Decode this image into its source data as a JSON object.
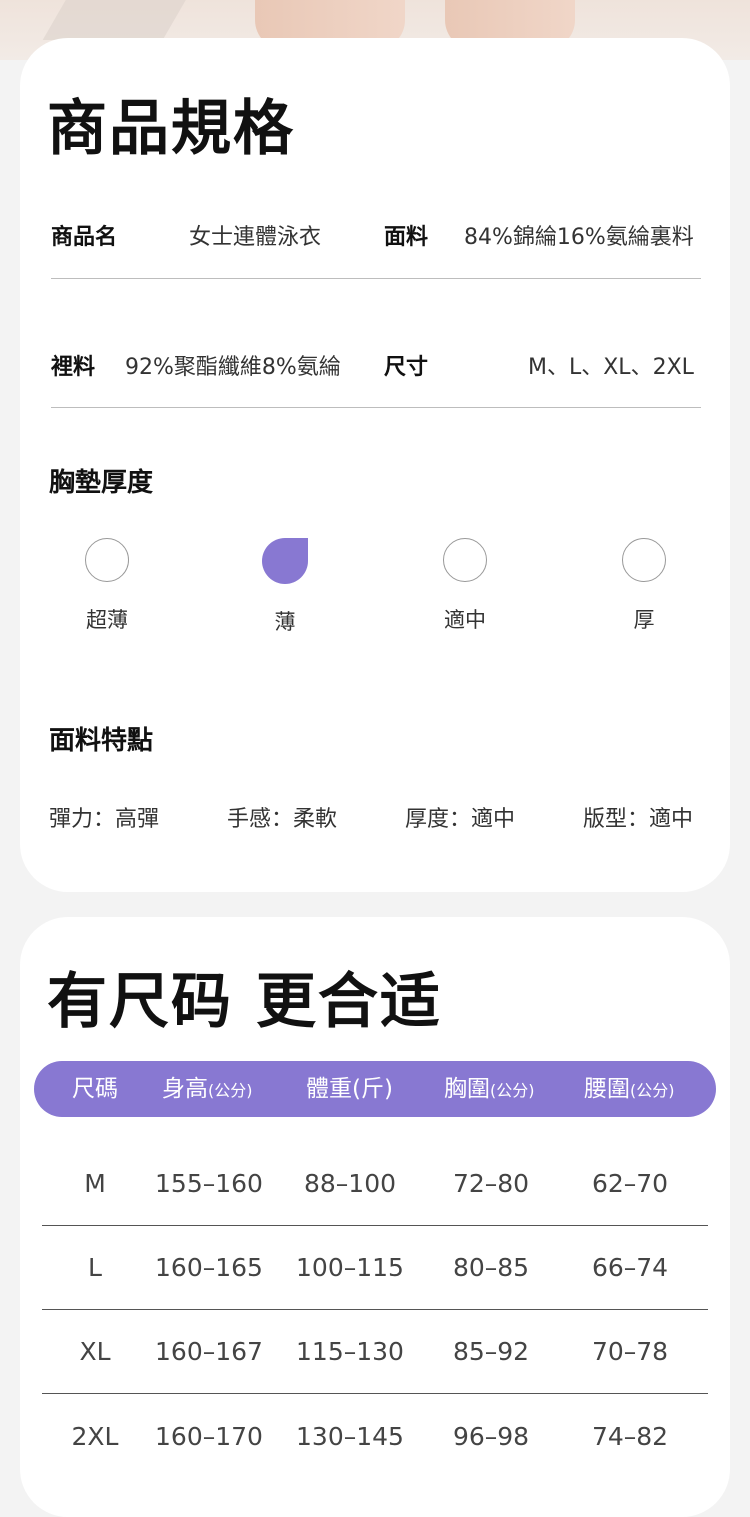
{
  "spec": {
    "title": "商品規格",
    "row1": {
      "name_label": "商品名",
      "name_value": "女士連體泳衣",
      "fabric_label": "面料",
      "fabric_value": "84%錦綸16%氨綸裏料"
    },
    "row2": {
      "lining_label": "裡料",
      "lining_value": "92%聚酯纖維8%氨綸",
      "size_label": "尺寸",
      "size_value": "M、L、XL、2XL"
    },
    "padding": {
      "title": "胸墊厚度",
      "options": [
        {
          "label": "超薄",
          "selected": false
        },
        {
          "label": "薄",
          "selected": true
        },
        {
          "label": "適中",
          "selected": false
        },
        {
          "label": "厚",
          "selected": false
        }
      ],
      "accent_color": "#8878d2"
    },
    "features": {
      "title": "面料特點",
      "items": [
        "彈力：高彈",
        "手感：柔軟",
        "厚度：適中",
        "版型：適中"
      ]
    }
  },
  "size_chart": {
    "title": "有尺码 更合适",
    "header": {
      "size": "尺碼",
      "height": "身高",
      "height_unit": "(公分)",
      "weight": "體重(斤)",
      "bust": "胸圍",
      "bust_unit": "(公分)",
      "waist": "腰圍",
      "waist_unit": "(公分)"
    },
    "rows": [
      [
        "M",
        "155–160",
        "88–100",
        "72–80",
        "62–70"
      ],
      [
        "L",
        "160–165",
        "100–115",
        "80–85",
        "66–74"
      ],
      [
        "XL",
        "160–167",
        "115–130",
        "85–92",
        "70–78"
      ],
      [
        "2XL",
        "160–170",
        "130–145",
        "96–98",
        "74–82"
      ]
    ]
  }
}
